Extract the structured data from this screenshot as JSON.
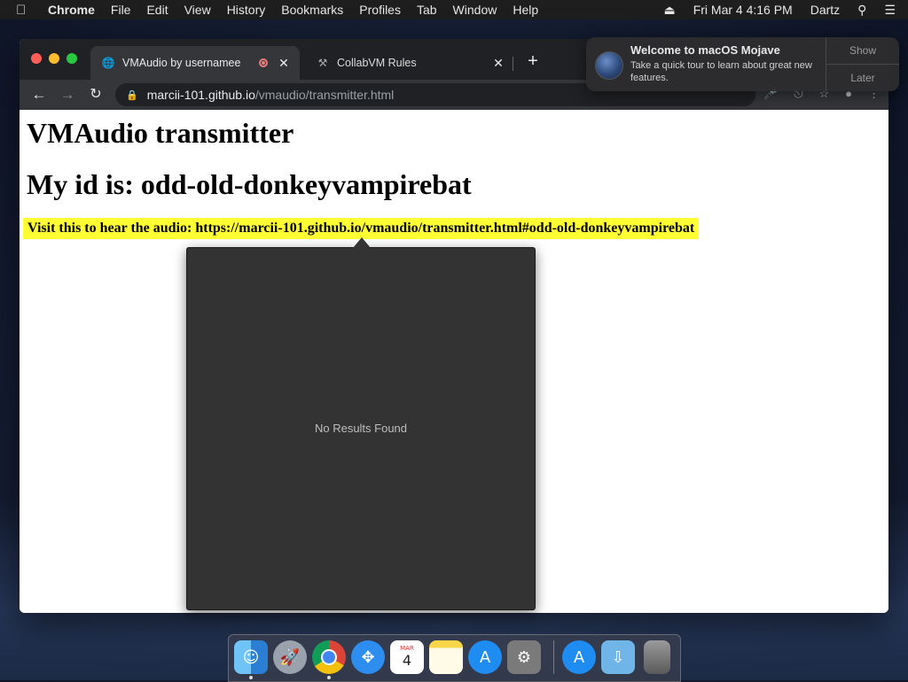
{
  "menubar": {
    "app_name": "Chrome",
    "items": [
      "File",
      "Edit",
      "View",
      "History",
      "Bookmarks",
      "Profiles",
      "Tab",
      "Window",
      "Help"
    ],
    "clock": "Fri Mar 4  4:16 PM",
    "user": "Dartz"
  },
  "browser": {
    "tabs": [
      {
        "title": "VMAudio by usernamee",
        "active": true
      },
      {
        "title": "CollabVM Rules",
        "active": false
      }
    ],
    "url_host": "marcii-101.github.io",
    "url_path": "/vmaudio/transmitter.html"
  },
  "page": {
    "heading": "VMAudio transmitter",
    "id_line": "My id is: odd-old-donkeyvampirebat",
    "visit_line": "Visit this to hear the audio: https://marcii-101.github.io/vmaudio/transmitter.html#odd-old-donkeyvampirebat"
  },
  "popover": {
    "empty_text": "No Results Found"
  },
  "notification": {
    "title": "Welcome to macOS Mojave",
    "message": "Take a quick tour to learn about great new features.",
    "show_label": "Show",
    "later_label": "Later"
  },
  "dock": {
    "items": [
      "finder-icon",
      "launchpad-icon",
      "chrome-icon",
      "safari-icon",
      "calendar-icon",
      "notes-icon",
      "app-store-icon",
      "system-preferences-icon",
      "app-store-folder-icon",
      "downloads-folder-icon",
      "trash-icon"
    ],
    "calendar_month": "MAR",
    "calendar_day": "4"
  }
}
